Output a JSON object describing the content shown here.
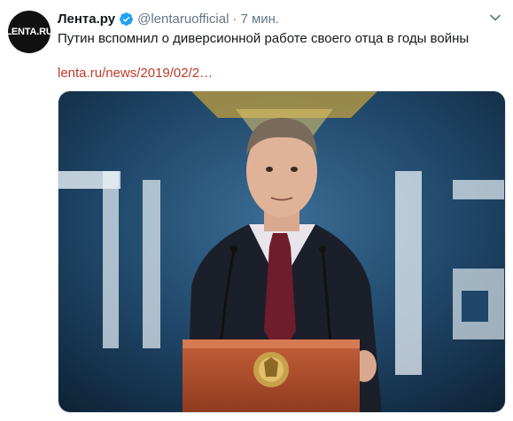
{
  "tweet": {
    "author_name": "Лента.ру",
    "handle": "@lentaruofficial",
    "separator": "·",
    "time": "7 мин.",
    "text": "Путин вспомнил о диверсионной работе своего отца в годы войны",
    "link": "lenta.ru/news/2019/02/2…"
  },
  "avatar": {
    "label": "LENTA.RU"
  },
  "icons": {
    "verified": "verified-badge-icon",
    "menu": "chevron-down-icon"
  },
  "colors": {
    "link": "#c0392b",
    "verified": "#1da1f2",
    "muted": "#657786"
  }
}
